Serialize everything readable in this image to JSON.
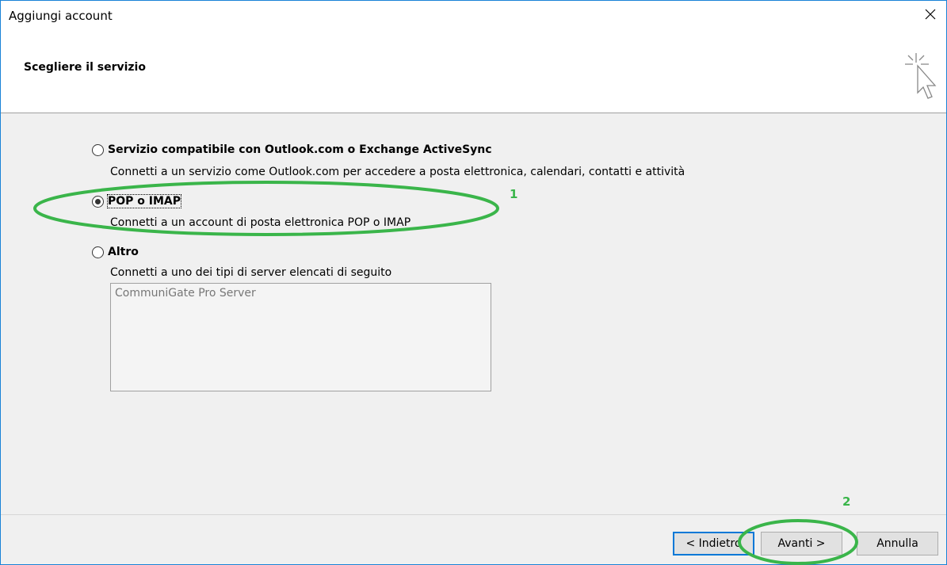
{
  "window": {
    "title": "Aggiungi account"
  },
  "header": {
    "title": "Scegliere il servizio"
  },
  "options": [
    {
      "label": "Servizio compatibile con Outlook.com o Exchange ActiveSync",
      "description": "Connetti a un servizio come Outlook.com per accedere a posta elettronica, calendari, contatti e attività",
      "selected": false
    },
    {
      "label": "POP o IMAP",
      "description": "Connetti a un account di posta elettronica POP o IMAP",
      "selected": true
    },
    {
      "label": "Altro",
      "description": "Connetti a uno dei tipi di server elencati di seguito",
      "selected": false
    }
  ],
  "server_list": {
    "items": [
      "CommuniGate Pro Server"
    ]
  },
  "buttons": {
    "back": "< Indietro",
    "next": "Avanti >",
    "cancel": "Annulla"
  },
  "annotations": {
    "one": "1",
    "two": "2",
    "color": "#3ab54a"
  },
  "colors": {
    "accent": "#0078d7",
    "border": "#1883d7"
  }
}
